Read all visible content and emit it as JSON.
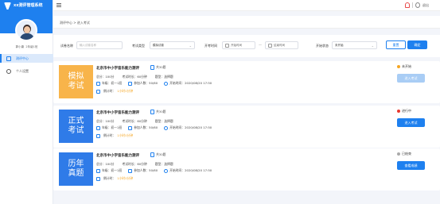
{
  "app": {
    "title": "xx测评管理系统"
  },
  "user": {
    "name": "郭小康",
    "class_info": "2年级1班"
  },
  "menu": [
    {
      "label": "测评中心"
    },
    {
      "label": "个人设置"
    }
  ],
  "topbar": {
    "exit_label": "退出"
  },
  "breadcrumb": "测评中心 > 进入考试",
  "filters": {
    "name_label": "试卷名称",
    "name_placeholder": "输入试卷名称",
    "type_label": "考试类型",
    "type_value": "模拟试卷",
    "time_label": "开考时间",
    "start_placeholder": "开始时间",
    "end_placeholder": "结束时间",
    "dash": "—",
    "status_label": "开始状态",
    "status_value": "未开始",
    "reset_label": "重置",
    "confirm_label": "确定"
  },
  "cards": [
    {
      "image_line1": "模拟",
      "image_line2": "考试",
      "image_color": "#f8b44a",
      "title": "北京市中小学音乐能力测评",
      "doc": "共30题",
      "total": "总分：100分",
      "duration": "考试时长：60分钟",
      "qtype": "题型：选择题",
      "grade": "年级：初一1班",
      "participants": "参加人数：50/60",
      "start": "开始时间：2020/08/20 17:50",
      "countdown_label": "倒计时：",
      "countdown_value": "1小时0分钟",
      "status": "未开始",
      "status_color": "#f5a623",
      "button": "进入考试",
      "button_color": "#a9cdf5"
    },
    {
      "image_line1": "正式",
      "image_line2": "考试",
      "image_color": "#2f7be8",
      "title": "北京市中小学音乐能力测评",
      "doc": "共30题",
      "total": "总分：100分",
      "duration": "考试时长：60分钟",
      "qtype": "题型：选择题",
      "grade": "年级：初一1班",
      "participants": "参加人数：50/60",
      "start": "开始时间：2020/08/20 17:50",
      "countdown_label": "倒计时：",
      "countdown_value": "1小时0分钟",
      "status": "进行中",
      "status_color": "#e8392f",
      "button": "进入考试",
      "button_color": "#1e80ef"
    },
    {
      "image_line1": "历年",
      "image_line2": "真题",
      "image_color": "#2f7be8",
      "title": "北京市中小学音乐能力测评",
      "doc": "共30题",
      "total": "总分：100分",
      "duration": "考试时长：60分钟",
      "qtype": "题型：选择题",
      "grade": "年级：初一1班",
      "participants": "参加人数：50/60",
      "start": "开始时间：2020/08/20 17:50",
      "countdown_label": "倒计时：",
      "countdown_value": "1小时0分钟",
      "status": "已结束",
      "status_color": "#aaaaaa",
      "button": "查看成绩",
      "button_color": "#1e80ef"
    }
  ]
}
